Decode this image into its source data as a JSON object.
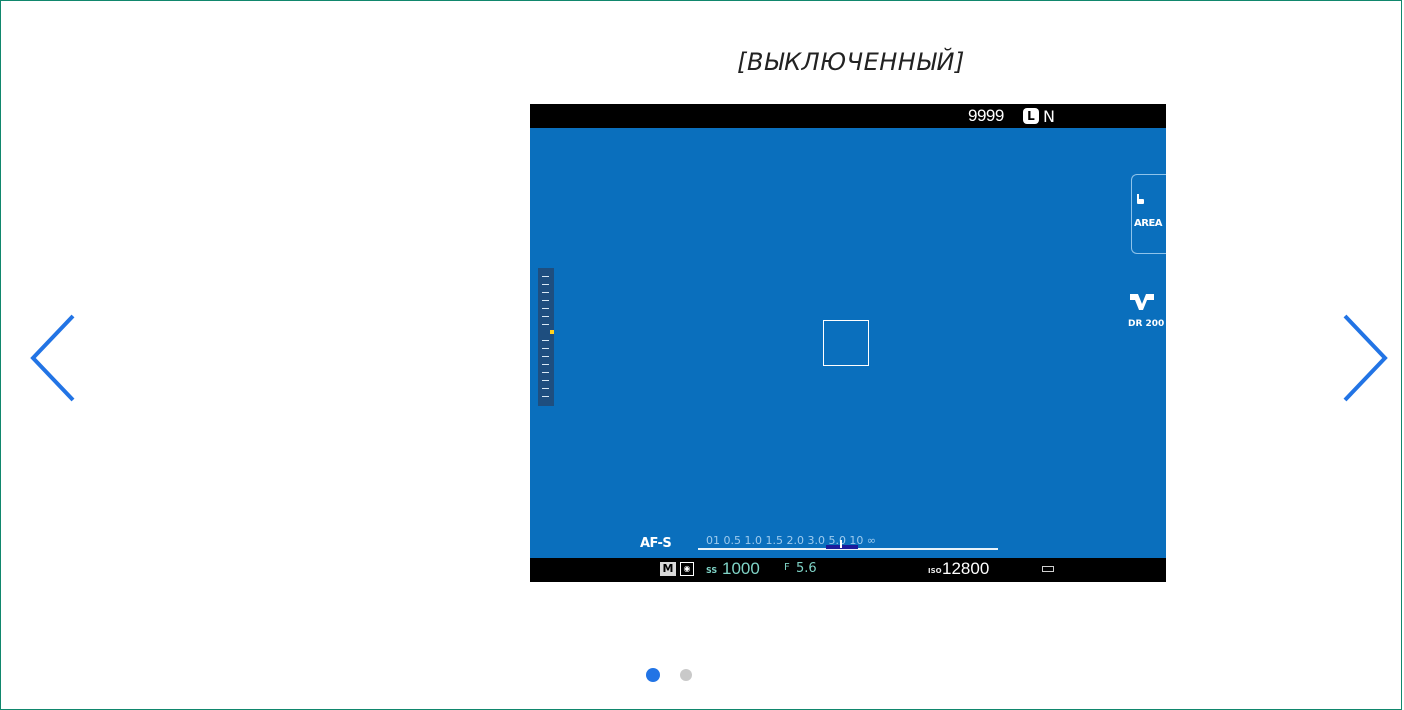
{
  "slide": {
    "caption": "[ВЫКЛЮЧЕННЫЙ]",
    "prev_icon": "chevron-left-icon",
    "next_icon": "chevron-right-icon",
    "accent_color": "#2274e5",
    "border_color": "#11876d"
  },
  "camera_display": {
    "top_bar": {
      "frames_remaining": "9999",
      "image_size": "L",
      "image_quality": "N"
    },
    "side_panel": {
      "focus_area_label": "AREA",
      "film_sim_label": "DR 200"
    },
    "af_mode": "AF-S",
    "distance_scale": "01 0.5   1.0   1.5   2.0   3.0   5.0  10  ∞",
    "bottom_bar": {
      "shooting_mode": "M",
      "shutter_prefix": "SS",
      "shutter_speed": "1000",
      "aperture_prefix": "F",
      "aperture": "5.6",
      "iso_prefix": "ISO",
      "iso": "12800"
    },
    "background_color": "#0a6fbd"
  },
  "pagination": {
    "current_page": 1,
    "total_pages": 2
  }
}
